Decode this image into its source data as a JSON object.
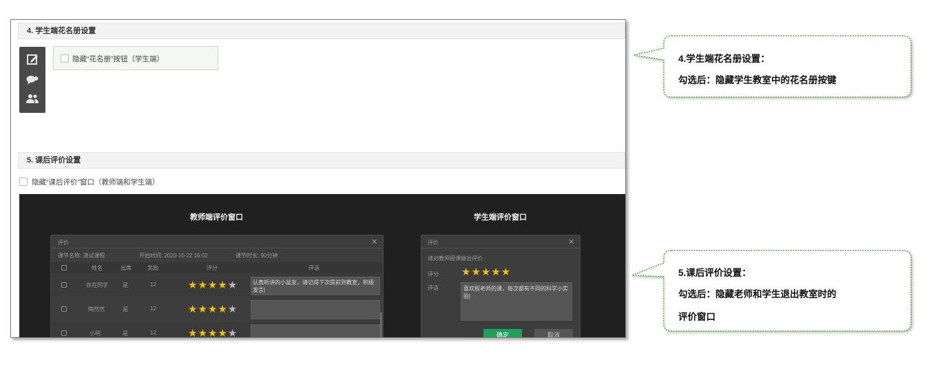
{
  "section4": {
    "header": "4. 学生端花名册设置",
    "checkbox_label": "隐藏“花名册”按钮（学生端）"
  },
  "section5": {
    "header": "5. 课后评价设置",
    "checkbox_label": "隐藏“课后评价”窗口（教师端和学生端）"
  },
  "preview": {
    "teacher_title": "教师端评价窗口",
    "student_title": "学生端评价窗口",
    "teacher_window": {
      "title": "评价",
      "close": "✕",
      "course_name": "课节名称: 测试课程",
      "start_time": "开始时间: 2020-10-22 16:02",
      "duration": "课节时长: 90分钟",
      "columns": [
        "姓名",
        "出席",
        "奖励",
        "评分",
        "评语"
      ],
      "rows": [
        {
          "name": "存在同学",
          "attend": "是",
          "reward": "12",
          "rating": 4,
          "comment": "认真听讲的小盆友，请记得下次提前到教室，积极发言|"
        },
        {
          "name": "陶然然",
          "attend": "是",
          "reward": "12",
          "rating": 4,
          "comment": ""
        },
        {
          "name": "小明",
          "attend": "是",
          "reward": "12",
          "rating": 4,
          "comment": ""
        }
      ]
    },
    "student_window": {
      "title": "评价",
      "close": "✕",
      "prompt": "请对教师授课做出评价",
      "rating_label": "评分",
      "rating": 5,
      "comment_label": "评语",
      "comment": "喜欢程老师的课，每次都有不同的科学小实验|",
      "confirm": "确定",
      "cancel": "取消"
    }
  },
  "callouts": [
    {
      "title": "4.学生端花名册设置：",
      "lines": [
        "勾选后：隐藏学生教室中的花名册按键"
      ]
    },
    {
      "title": "5.课后评价设置：",
      "lines": [
        "勾选后：隐藏老师和学生退出教室时的",
        "评价窗口"
      ]
    }
  ],
  "colors": {
    "accent_green": "#1f9f5c",
    "callout_border": "#62a34d",
    "star": "#f2c200",
    "dark_bg": "#202020"
  },
  "icons": [
    "edit-icon",
    "chat-icon",
    "people-icon"
  ]
}
